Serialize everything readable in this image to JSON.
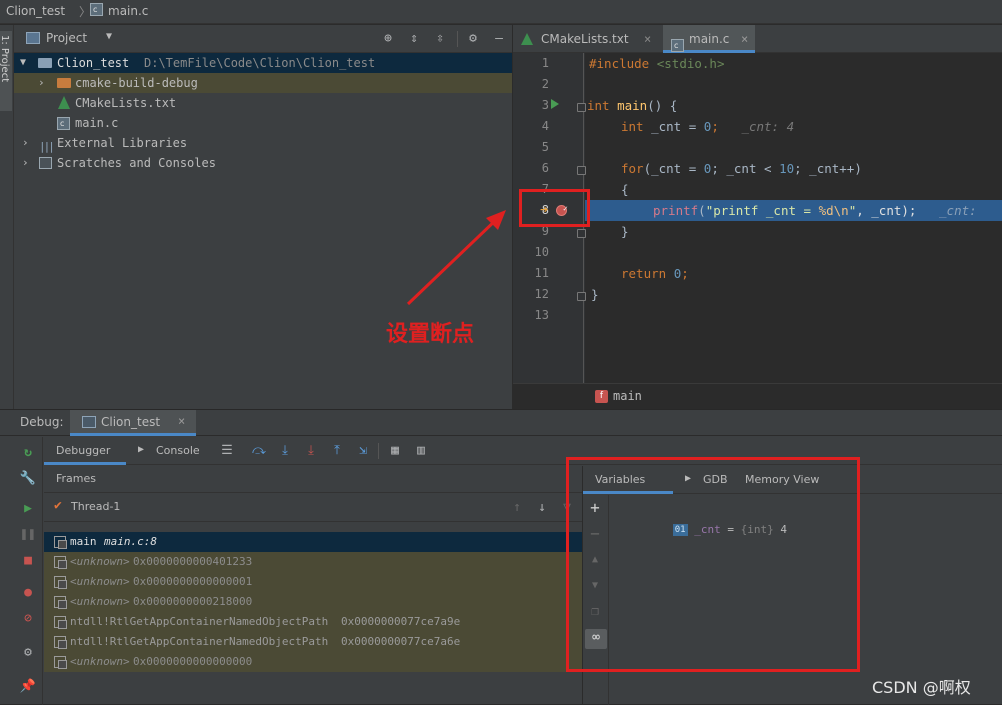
{
  "breadcrumb": {
    "project": "Clion_test",
    "file": "main.c"
  },
  "left_strip": {
    "label": "1: Project"
  },
  "project_panel": {
    "title": "Project",
    "root": {
      "name": "Clion_test",
      "path": "D:\\TemFile\\Code\\Clion\\Clion_test"
    },
    "items": [
      {
        "name": "cmake-build-debug"
      },
      {
        "name": "CMakeLists.txt"
      },
      {
        "name": "main.c"
      }
    ],
    "external_libraries": "External Libraries",
    "scratches": "Scratches and Consoles"
  },
  "editor": {
    "tabs": [
      {
        "label": "CMakeLists.txt"
      },
      {
        "label": "main.c"
      }
    ],
    "line_numbers": [
      "1",
      "2",
      "3",
      "4",
      "5",
      "6",
      "7",
      "8",
      "9",
      "10",
      "11",
      "12",
      "13"
    ],
    "code": {
      "l1_include": "#include",
      "l1_header": "<stdio.h>",
      "l3_int": "int",
      "l3_main": "main",
      "l3_rest": "() {",
      "l4_int": "int",
      "l4_var": "_cnt = ",
      "l4_zero": "0",
      "l4_semi": ";",
      "l4_hint": "_cnt: 4",
      "l6_for": "for",
      "l6_a": "(_cnt = ",
      "l6_zero": "0",
      "l6_b": "; _cnt < ",
      "l6_ten": "10",
      "l6_c": "; _cnt++)",
      "l7": "{",
      "l8_printf": "printf",
      "l8_open": "(",
      "l8_str1": "\"printf _cnt = ",
      "l8_fmt": "%d\\n",
      "l8_str2": "\"",
      "l8_rest": ", _cnt);",
      "l8_hint": "_cnt:",
      "l9": "}",
      "l11_return": "return",
      "l11_zero": "0",
      "l11_semi": ";",
      "l12": "}"
    },
    "breadcrumb_function": "main",
    "breadcrumb_icon_letter": "f"
  },
  "annotation": {
    "text": "设置断点",
    "color": "#e02020"
  },
  "debug": {
    "label": "Debug:",
    "config_tab": "Clion_test",
    "tabs": {
      "debugger": "Debugger",
      "console": "Console"
    },
    "frames_header": "Frames",
    "thread": "Thread-1",
    "frames": [
      {
        "prefix": "main ",
        "detail": "main.c:8"
      },
      {
        "prefix": "<unknown>",
        "detail": " 0x0000000000401233"
      },
      {
        "prefix": "<unknown>",
        "detail": " 0x0000000000000001"
      },
      {
        "prefix": "<unknown>",
        "detail": " 0x0000000000218000"
      },
      {
        "prefix": "ntdll!RtlGetAppContainerNamedObjectPath",
        "detail": " 0x0000000077ce7a9e"
      },
      {
        "prefix": "ntdll!RtlGetAppContainerNamedObjectPath",
        "detail": " 0x0000000077ce7a6e"
      },
      {
        "prefix": "<unknown>",
        "detail": " 0x0000000000000000"
      }
    ],
    "vars_tabs": {
      "variables": "Variables",
      "gdb": "GDB",
      "memory": "Memory View"
    },
    "variable": {
      "badge": "01",
      "name": "_cnt",
      "eq": " = ",
      "type": "{int}",
      "value": " 4"
    }
  },
  "watermark": "CSDN @啊权",
  "colors": {
    "highlight_line": "#2d5c8e",
    "selected_frame": "#0d293e",
    "frame_bg": "#4b4a35",
    "annotation_red": "#e02020",
    "exec_arrow": "#e8a33c"
  }
}
